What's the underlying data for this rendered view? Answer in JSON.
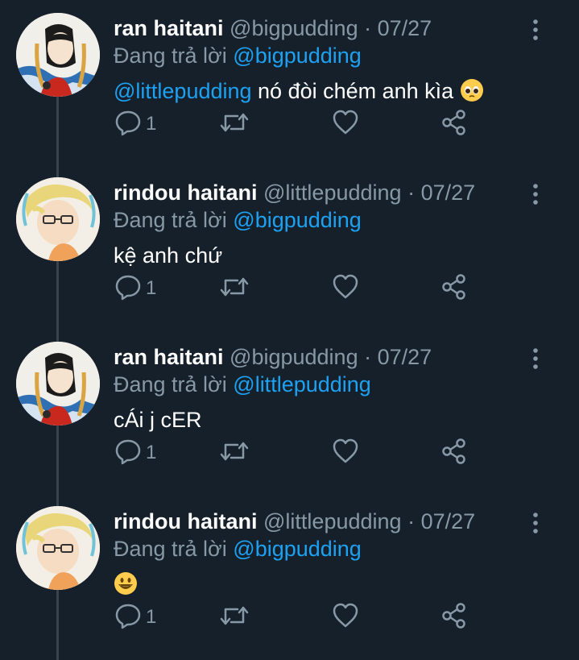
{
  "colors": {
    "background": "#15202b",
    "muted": "#8899a6",
    "link": "#1da1f2",
    "thread_line": "#38444d"
  },
  "tweets": [
    {
      "name": "ran haitani",
      "handle": "@bigpudding",
      "sep": "·",
      "date": "07/27",
      "reply_prefix": "Đang trả lời",
      "reply_to": "@bigpudding",
      "mention": "@littlepudding",
      "text": " nó đòi chém anh kìa ",
      "emoji": "pleading-face-emoji",
      "reply_count": "1",
      "avatar": "ran-avatar"
    },
    {
      "name": "rindou haitani",
      "handle": "@littlepudding",
      "sep": "·",
      "date": "07/27",
      "reply_prefix": "Đang trả lời",
      "reply_to": "@bigpudding",
      "mention": "",
      "text": "kệ anh chứ",
      "emoji": "",
      "reply_count": "1",
      "avatar": "rindou-avatar"
    },
    {
      "name": "ran haitani",
      "handle": "@bigpudding",
      "sep": "·",
      "date": "07/27",
      "reply_prefix": "Đang trả lời",
      "reply_to": "@littlepudding",
      "mention": "",
      "text": "cÁi j cER",
      "emoji": "",
      "reply_count": "1",
      "avatar": "ran-avatar"
    },
    {
      "name": "rindou haitani",
      "handle": "@littlepudding",
      "sep": "·",
      "date": "07/27",
      "reply_prefix": "Đang trả lời",
      "reply_to": "@bigpudding",
      "mention": "",
      "text": "",
      "emoji": "grinning-face-emoji",
      "reply_count": "1",
      "avatar": "rindou-avatar"
    }
  ]
}
